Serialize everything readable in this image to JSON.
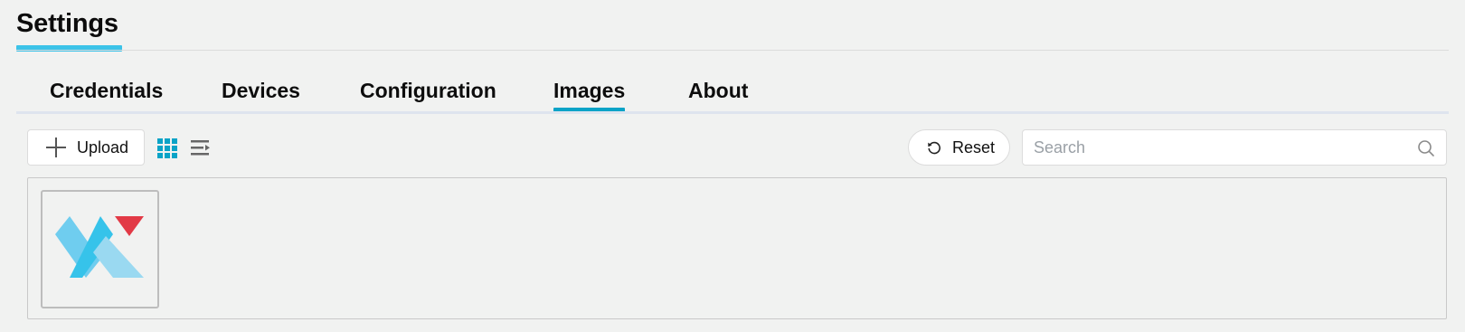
{
  "page": {
    "title": "Settings"
  },
  "tabs": [
    {
      "label": "Credentials",
      "active": false
    },
    {
      "label": "Devices",
      "active": false
    },
    {
      "label": "Configuration",
      "active": false
    },
    {
      "label": "Images",
      "active": true
    },
    {
      "label": "About",
      "active": false
    }
  ],
  "toolbar": {
    "upload_label": "Upload",
    "upload_icon": "plus-icon",
    "grid_view_icon": "grid-view-icon",
    "list_view_icon": "list-view-icon",
    "reset_label": "Reset",
    "reset_icon": "refresh-icon"
  },
  "search": {
    "placeholder": "Search",
    "value": "",
    "icon": "search-icon"
  },
  "gallery": {
    "images": [
      {
        "icon": "logo-image"
      }
    ]
  },
  "colors": {
    "accent": "#0aa3c7",
    "title_accent": "#3cc3e8",
    "background": "#f1f2f1",
    "logo_blue_dark": "#36c3ea",
    "logo_blue_light": "#9ad9f1",
    "logo_red": "#e23a46"
  }
}
